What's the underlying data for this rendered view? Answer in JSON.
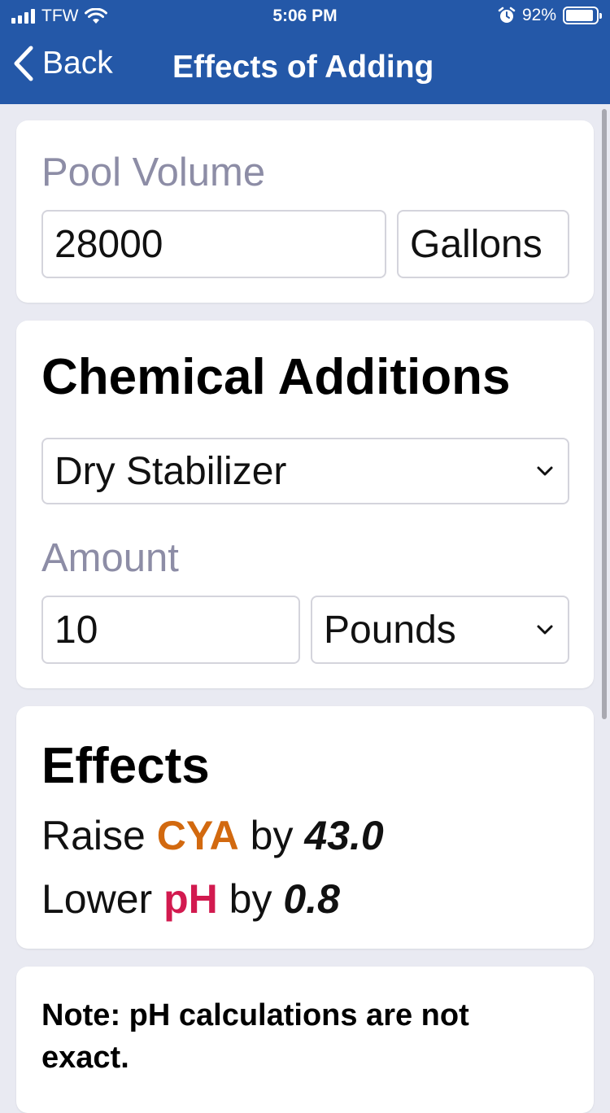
{
  "status_bar": {
    "carrier": "TFW",
    "time": "5:06 PM",
    "battery": "92%",
    "battery_level": 0.92
  },
  "nav": {
    "back_label": "Back",
    "title": "Effects of Adding"
  },
  "pool_volume": {
    "label": "Pool Volume",
    "value": "28000",
    "unit": "Gallons"
  },
  "chemical_additions": {
    "title": "Chemical Additions",
    "chemical": "Dry Stabilizer",
    "amount_label": "Amount",
    "amount_value": "10",
    "amount_unit": "Pounds"
  },
  "effects": {
    "title": "Effects",
    "lines": [
      {
        "verb": "Raise",
        "chemical": "CYA",
        "by": "by",
        "value": "43.0",
        "color": "#d2690f"
      },
      {
        "verb": "Lower",
        "chemical": "pH",
        "by": "by",
        "value": "0.8",
        "color": "#d21a4f"
      }
    ]
  },
  "note": {
    "text": "Note: pH calculations are not exact."
  },
  "colors": {
    "header": "#2458a8",
    "background": "#e9eaf2",
    "label": "#8d8da6"
  },
  "icons": [
    "wifi-icon",
    "alarm-icon",
    "battery-icon",
    "chevron-left-icon",
    "chevron-down-icon"
  ]
}
